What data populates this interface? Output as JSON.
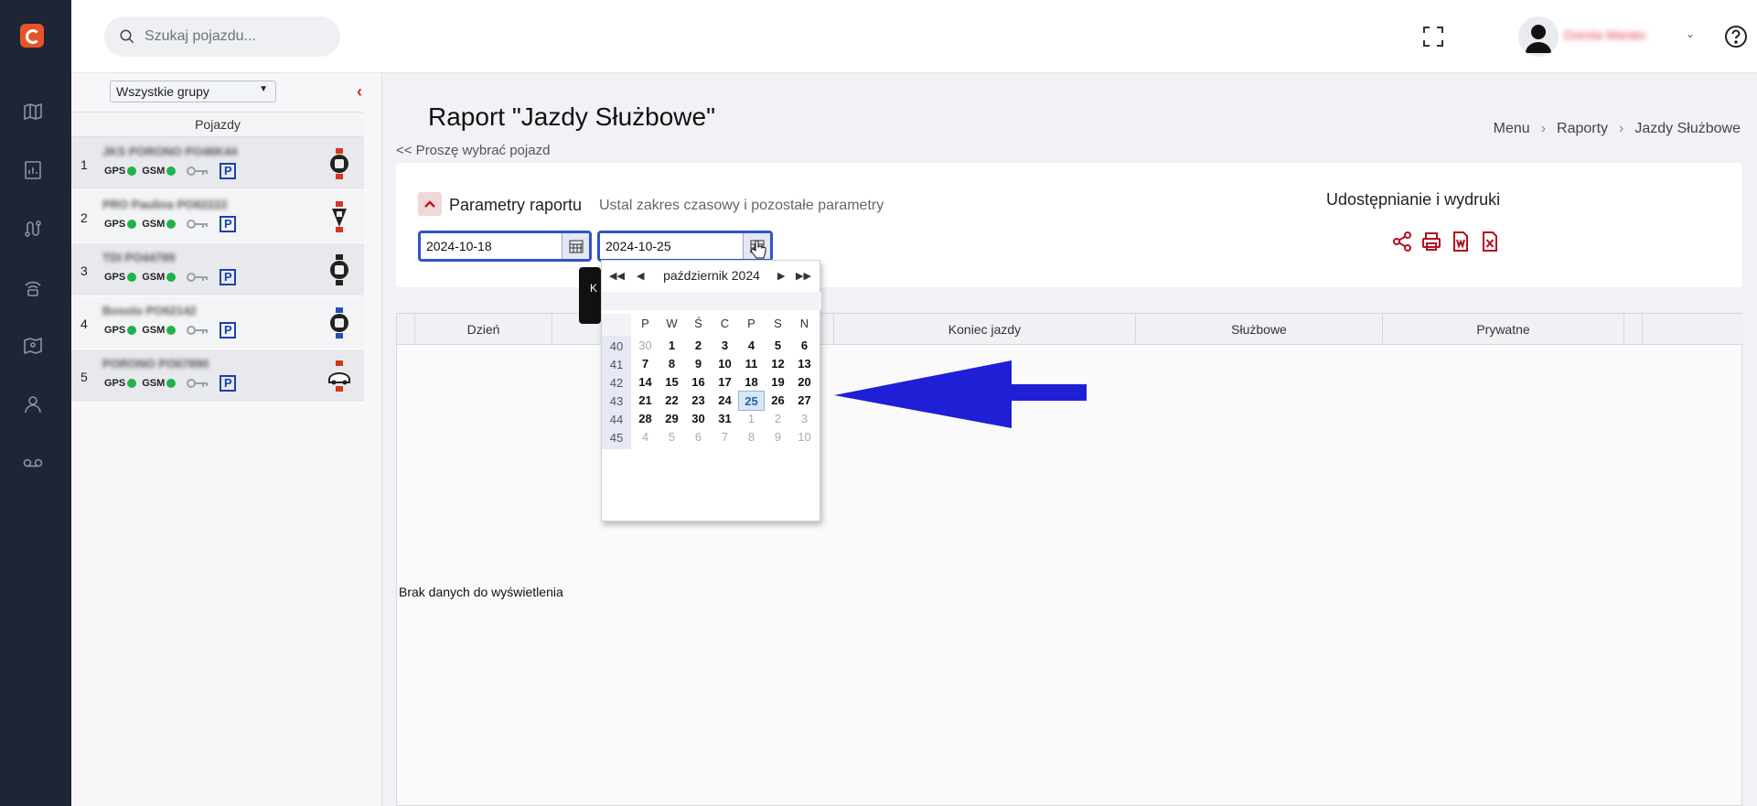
{
  "search": {
    "placeholder": "Szukaj pojazdu..."
  },
  "user": {
    "name": "Dorota Marato"
  },
  "sidebar": {
    "group_select": "Wszystkie grupy",
    "vehicles_header": "Pojazdy",
    "vehicles": [
      {
        "num": "1",
        "name": "JKS PORONO PO46K44",
        "gps": "GPS",
        "gsm": "GSM",
        "parking": "P"
      },
      {
        "num": "2",
        "name": "PRO Paulina PO82222",
        "gps": "GPS",
        "gsm": "GSM",
        "parking": "P"
      },
      {
        "num": "3",
        "name": "TDI PO44789",
        "gps": "GPS",
        "gsm": "GSM",
        "parking": "P"
      },
      {
        "num": "4",
        "name": "Bosolo PO62142",
        "gps": "GPS",
        "gsm": "GSM",
        "parking": "P"
      },
      {
        "num": "5",
        "name": "PORONO PO67890",
        "gps": "GPS",
        "gsm": "GSM",
        "parking": "P"
      }
    ]
  },
  "main": {
    "title": "Raport \"Jazdy Służbowe\"",
    "back_link": "<< Proszę wybrać pojazd",
    "breadcrumb": [
      "Menu",
      "Raporty",
      "Jazdy Służbowe"
    ],
    "params_title": "Parametry raportu",
    "params_subtitle": "Ustal zakres czasowy i pozostałe parametry",
    "date_from": "2024-10-18",
    "date_to": "2024-10-25",
    "share_title": "Udostępnianie i wydruki",
    "columns": [
      "Dzień",
      "",
      "",
      "Koniec jazdy",
      "Służbowe",
      "Prywatne"
    ],
    "no_data": "Brak danych do wyświetlenia",
    "tooltip_letter": "K"
  },
  "calendar": {
    "month": "październik 2024",
    "weekdays": [
      "P",
      "W",
      "Ś",
      "C",
      "P",
      "S",
      "N"
    ],
    "weeks": [
      {
        "wk": "40",
        "days": [
          "30",
          "1",
          "2",
          "3",
          "4",
          "5",
          "6"
        ]
      },
      {
        "wk": "41",
        "days": [
          "7",
          "8",
          "9",
          "10",
          "11",
          "12",
          "13"
        ]
      },
      {
        "wk": "42",
        "days": [
          "14",
          "15",
          "16",
          "17",
          "18",
          "19",
          "20"
        ]
      },
      {
        "wk": "43",
        "days": [
          "21",
          "22",
          "23",
          "24",
          "25",
          "26",
          "27"
        ]
      },
      {
        "wk": "44",
        "days": [
          "28",
          "29",
          "30",
          "31",
          "1",
          "2",
          "3"
        ]
      },
      {
        "wk": "45",
        "days": [
          "4",
          "5",
          "6",
          "7",
          "8",
          "9",
          "10"
        ]
      }
    ],
    "selected": "25"
  },
  "colors": {
    "accent_blue": "#2f54c5",
    "arrow_blue": "#1f1fd6",
    "icon_red": "#b3101c",
    "rail_bg": "#1e2636"
  }
}
